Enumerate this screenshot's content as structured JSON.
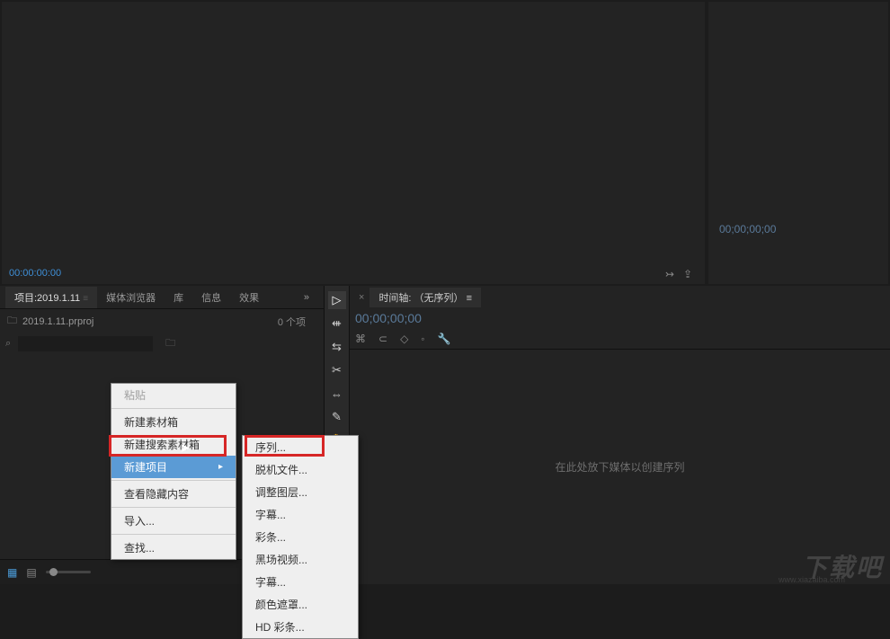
{
  "panels": {
    "source": {
      "timecode": "00:00:00:00"
    },
    "program": {
      "timecode": "00;00;00;00"
    }
  },
  "project": {
    "tabs": {
      "project": "项目:2019.1.11",
      "media_browser": "媒体浏览器",
      "library": "库",
      "info": "信息",
      "effects": "效果"
    },
    "filename": "2019.1.11.prproj",
    "item_count": "0 个项",
    "search_placeholder": ""
  },
  "timeline": {
    "tab_label": "时间轴: （无序列）",
    "timecode": "00;00;00;00",
    "placeholder": "在此处放下媒体以创建序列"
  },
  "context_menu_1": {
    "paste": "粘贴",
    "new_bin": "新建素材箱",
    "new_search_bin": "新建搜索素材箱",
    "new_item": "新建项目",
    "view_hidden": "查看隐藏内容",
    "import": "导入...",
    "find": "查找..."
  },
  "context_menu_2": {
    "sequence": "序列...",
    "offline_file": "脱机文件...",
    "adjust_layer": "调整图层...",
    "title": "字幕...",
    "color_bars": "彩条...",
    "black_video": "黑场视频...",
    "caption": "字幕...",
    "color_matte": "颜色遮罩...",
    "hd_bars": "HD 彩条..."
  },
  "watermark": {
    "text": "下载吧",
    "url": "www.xiazaiba.com"
  }
}
